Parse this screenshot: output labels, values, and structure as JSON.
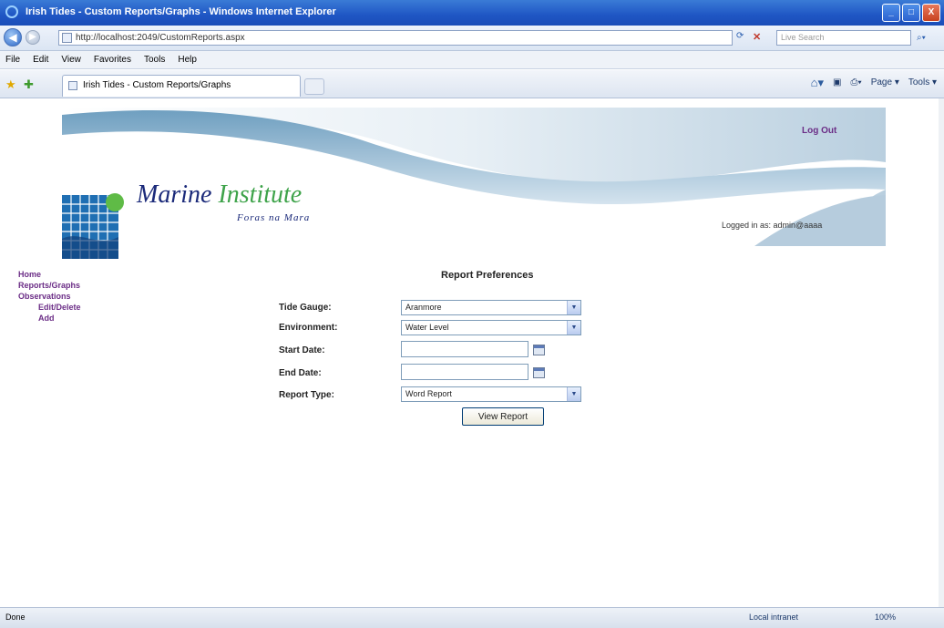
{
  "window": {
    "title": "Irish Tides - Custom Reports/Graphs - Windows Internet Explorer"
  },
  "window_buttons": {
    "minimize": "_",
    "maximize": "□",
    "close": "X"
  },
  "address_bar": {
    "url": "http://localhost:2049/CustomReports.aspx",
    "search_placeholder": "Live Search"
  },
  "menu": [
    "File",
    "Edit",
    "View",
    "Favorites",
    "Tools",
    "Help"
  ],
  "tab": {
    "label": "Irish Tides - Custom Reports/Graphs"
  },
  "command_bar": {
    "page": "Page ▾",
    "tools": "Tools ▾"
  },
  "header": {
    "logout": "Log Out",
    "logged_in": "Logged in as: admin@aaaa",
    "logo_main": "Marine",
    "logo_accent": "Institute",
    "logo_sub": "Foras na Mara"
  },
  "sidebar": {
    "items": [
      {
        "label": "Home"
      },
      {
        "label": "Reports/Graphs"
      },
      {
        "label": "Observations"
      },
      {
        "label": "Edit/Delete"
      },
      {
        "label": "Add"
      }
    ]
  },
  "form": {
    "title": "Report Preferences",
    "tide_gauge": {
      "label": "Tide Gauge:",
      "value": "Aranmore"
    },
    "environment": {
      "label": "Environment:",
      "value": "Water Level"
    },
    "start_date": {
      "label": "Start Date:",
      "value": ""
    },
    "end_date": {
      "label": "End Date:",
      "value": ""
    },
    "report_type": {
      "label": "Report Type:",
      "value": "Word Report"
    },
    "view_button": "View Report"
  },
  "status_bar": {
    "left": "Done",
    "zone": "Local intranet",
    "zoom": "100%"
  }
}
